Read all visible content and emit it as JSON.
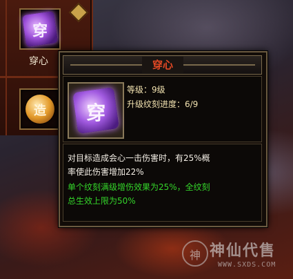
{
  "skill_panel": {
    "skill1_label": "穿心",
    "skill1_glyph": "穿",
    "skill2_glyph": "造"
  },
  "tooltip": {
    "title": "穿心",
    "icon_glyph": "穿",
    "level_line": "等级：9级",
    "progress_line": "升级纹刻进度：6/9",
    "desc_line1": "对目标造成会心一击伤害时，有25%概",
    "desc_line2": "率使此伤害增加22%",
    "bonus_line1": "单个纹刻满级增伤效果为25%，全纹刻",
    "bonus_line2": "总生效上限为50%"
  },
  "colors": {
    "title": "#e34824",
    "info": "#f2e2b0",
    "bonus": "#34d52a"
  },
  "watermark": {
    "logo_char": "神",
    "name": "神仙代售",
    "url": "WWW.SXDS.COM"
  }
}
